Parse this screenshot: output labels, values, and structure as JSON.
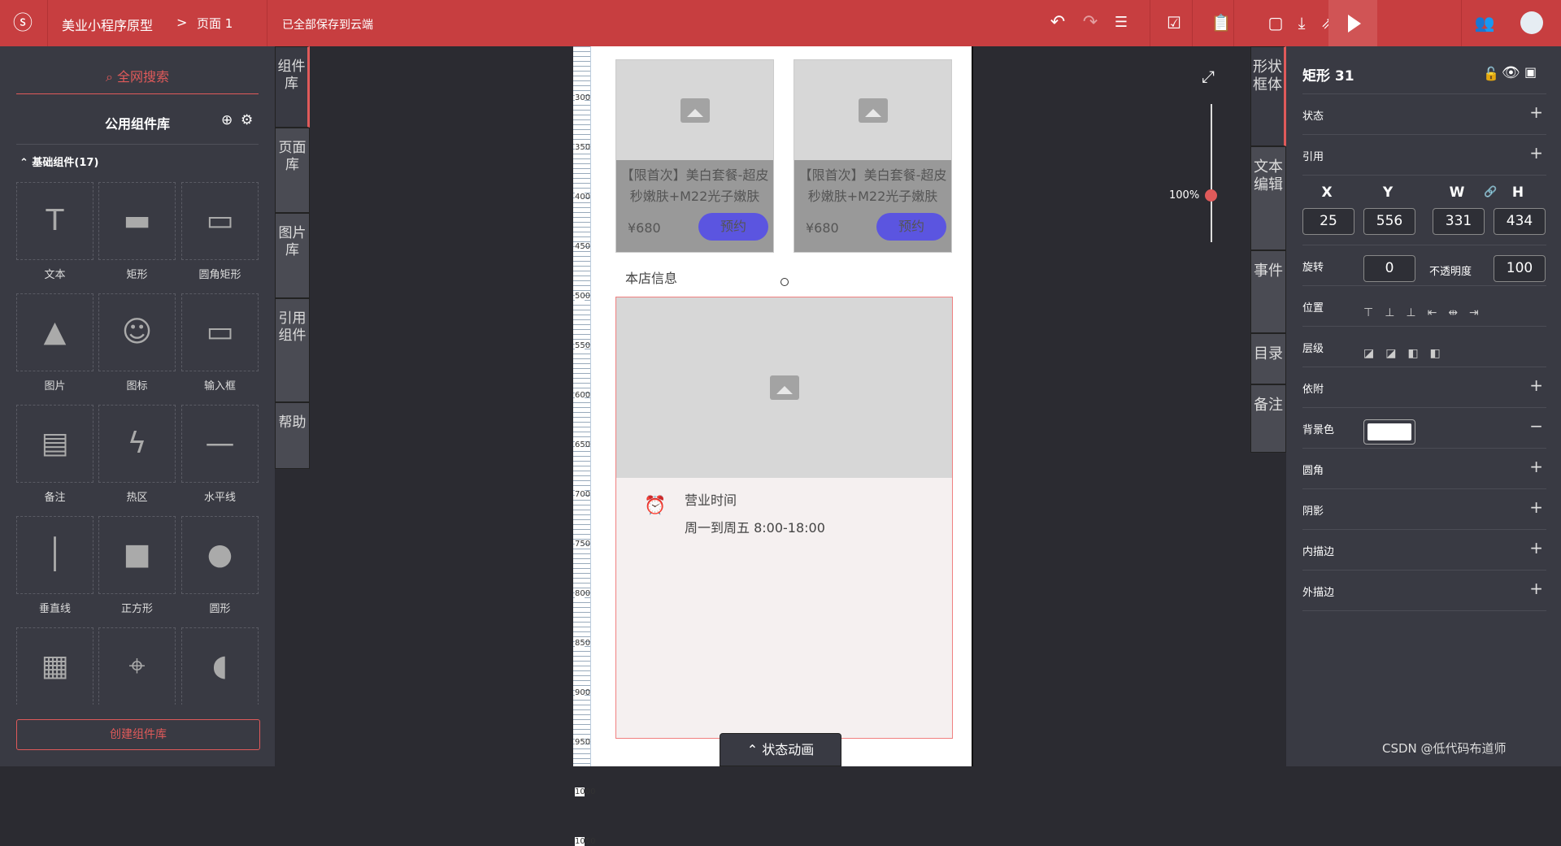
{
  "topbar": {
    "project": "美业小程序原型",
    "separator": ">",
    "page": "页面 1",
    "save_status": "已全部保存到云端",
    "icons": [
      "undo-icon",
      "redo-icon",
      "history-icon",
      "check-icon",
      "clipboard-icon",
      "save-icon",
      "download-icon",
      "share-icon",
      "more-icon",
      "play-icon",
      "add-user-icon",
      "avatar"
    ],
    "accent": "#c73e40"
  },
  "left": {
    "search": "全网搜索",
    "library_title": "公用组件库",
    "section": "基础组件(17)",
    "create_button": "创建组件库",
    "components": [
      {
        "label": "文本"
      },
      {
        "label": "矩形"
      },
      {
        "label": "圆角矩形"
      },
      {
        "label": "图片"
      },
      {
        "label": "图标"
      },
      {
        "label": "输入框"
      },
      {
        "label": "备注"
      },
      {
        "label": "热区"
      },
      {
        "label": "水平线"
      },
      {
        "label": "垂直线"
      },
      {
        "label": "正方形"
      },
      {
        "label": "圆形"
      },
      {
        "label": ""
      },
      {
        "label": ""
      },
      {
        "label": ""
      }
    ]
  },
  "side_tabs": [
    "组件库",
    "页面库",
    "图片库",
    "引用组件",
    "帮助"
  ],
  "right_tabs": [
    "形状框体",
    "文本编辑",
    "事件",
    "目录",
    "备注"
  ],
  "canvas": {
    "ruler": [
      "300",
      "350",
      "400",
      "450",
      "500",
      "550",
      "600",
      "650",
      "700",
      "750",
      "800",
      "850",
      "900",
      "950",
      "1000",
      "1050"
    ],
    "cards": [
      {
        "title": "【限首次】美白套餐-超皮秒嫩肤+M22光子嫩肤",
        "price": "¥680",
        "button": "预约"
      },
      {
        "title": "【限首次】美白套餐-超皮秒嫩肤+M22光子嫩肤",
        "price": "¥680",
        "button": "预约"
      }
    ],
    "store_info": "本店信息",
    "hours_label": "营业时间",
    "hours_value": "周一到周五 8:00-18:00",
    "zoom": "100%",
    "state_animation": "状态动画",
    "book_color": "#5b55e0"
  },
  "props": {
    "title": "矩形 31",
    "rows": {
      "state": "状态",
      "ref": "引用",
      "rotate": "旋转",
      "opacity": "不透明度",
      "position": "位置",
      "layer": "层级",
      "attach": "依附",
      "bg": "背景色",
      "radius": "圆角",
      "shadow": "阴影",
      "inner": "内描边",
      "outer": "外描边"
    },
    "x_label": "X",
    "y_label": "Y",
    "w_label": "W",
    "h_label": "H",
    "x": "25",
    "y": "556",
    "w": "331",
    "h": "434",
    "rotation": "0",
    "opacity_value": "100",
    "bg_color": "#ffffff"
  },
  "watermark": "CSDN @低代码布道师"
}
